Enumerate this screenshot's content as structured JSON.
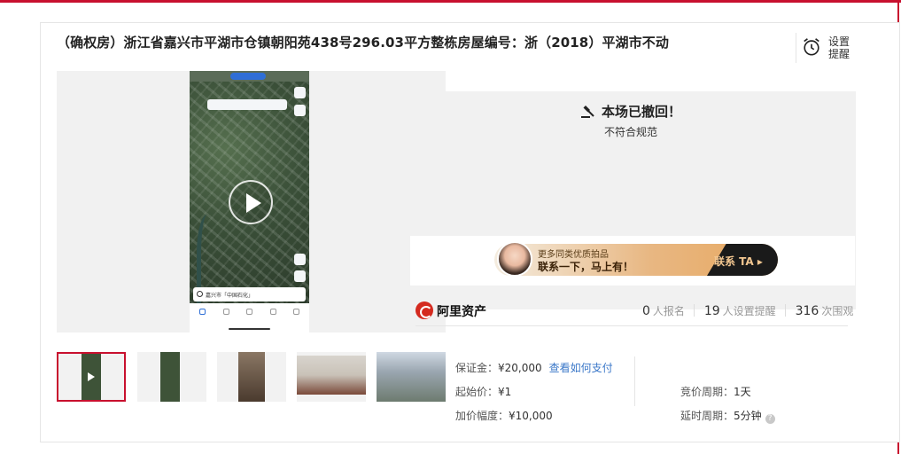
{
  "title": "（确权房）浙江省嘉兴市平湖市仓镇朝阳苑438号296.03平方整栋房屋编号：浙（2018）平湖市不动",
  "remind": {
    "label_line1": "设置",
    "label_line2": "提醒"
  },
  "status": {
    "headline": "本场已撤回！",
    "reason": "不符合规范"
  },
  "banner": {
    "line1": "更多同类优质拍品",
    "line2": "联系一下，马上有！",
    "cta": "联系 TA ▸"
  },
  "phone": {
    "search_text": "嘉兴市「中国石化」"
  },
  "brand": {
    "name": "阿里资产"
  },
  "stats": [
    {
      "num": "0",
      "unit": "人报名"
    },
    {
      "num": "19",
      "unit": "人设置提醒"
    },
    {
      "num": "316",
      "unit": "次围观"
    }
  ],
  "info": {
    "deposit_label": "保证金：",
    "deposit_value": "¥20,000",
    "deposit_link": "查看如何支付",
    "start_label": "起始价：",
    "start_value": "¥1",
    "step_label": "加价幅度：",
    "step_value": "¥10,000",
    "period_label": "竞价周期：",
    "period_value": "1天",
    "delay_label": "延时周期：",
    "delay_value": "5分钟"
  },
  "colors": {
    "accent": "#c8102e",
    "link": "#3a77c8"
  }
}
